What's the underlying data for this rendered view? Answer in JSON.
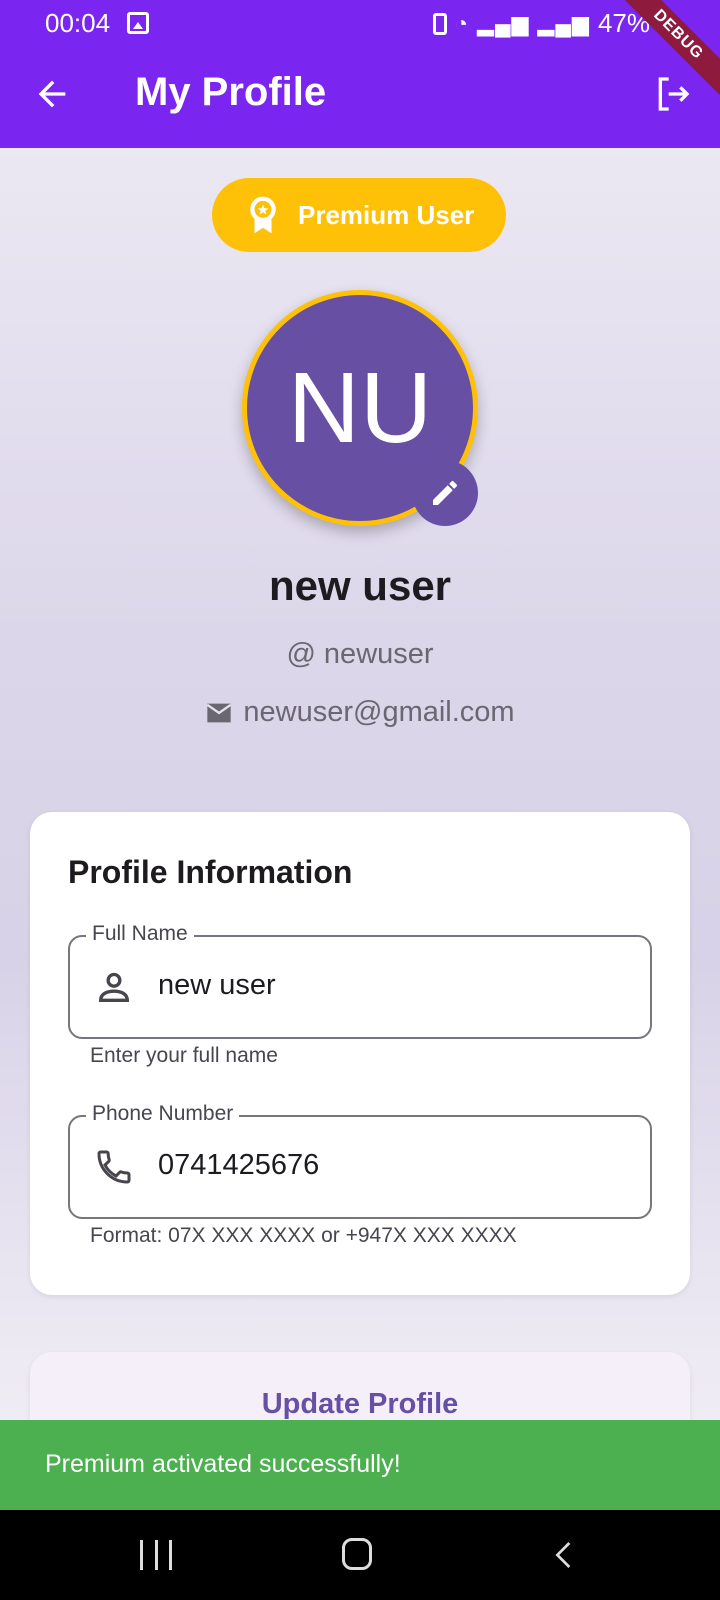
{
  "status_bar": {
    "time": "00:04",
    "battery": "47%",
    "debug_banner": "DEBUG"
  },
  "app_bar": {
    "title": "My Profile",
    "back_icon": "arrow-back-icon",
    "logout_icon": "logout-icon"
  },
  "badge": {
    "label": "Premium User",
    "icon": "award-icon",
    "color": "#ffc107"
  },
  "avatar": {
    "initials": "NU",
    "edit_icon": "pencil-icon",
    "color": "#6750a4"
  },
  "user": {
    "full_name": "new user",
    "username": "@ newuser",
    "email": "newuser@gmail.com"
  },
  "profile_card": {
    "title": "Profile Information",
    "full_name_field": {
      "label": "Full Name",
      "value": "new user",
      "helper": "Enter your full name",
      "icon": "person-icon"
    },
    "phone_field": {
      "label": "Phone Number",
      "value": "0741425676",
      "helper": "Format: 07X XXX XXXX or +947X XXX XXXX",
      "icon": "phone-icon"
    }
  },
  "update_button": {
    "label": "Update Profile"
  },
  "snackbar": {
    "message": "Premium activated successfully!",
    "color": "#4caf50"
  },
  "brand_color": "#7b25f0"
}
